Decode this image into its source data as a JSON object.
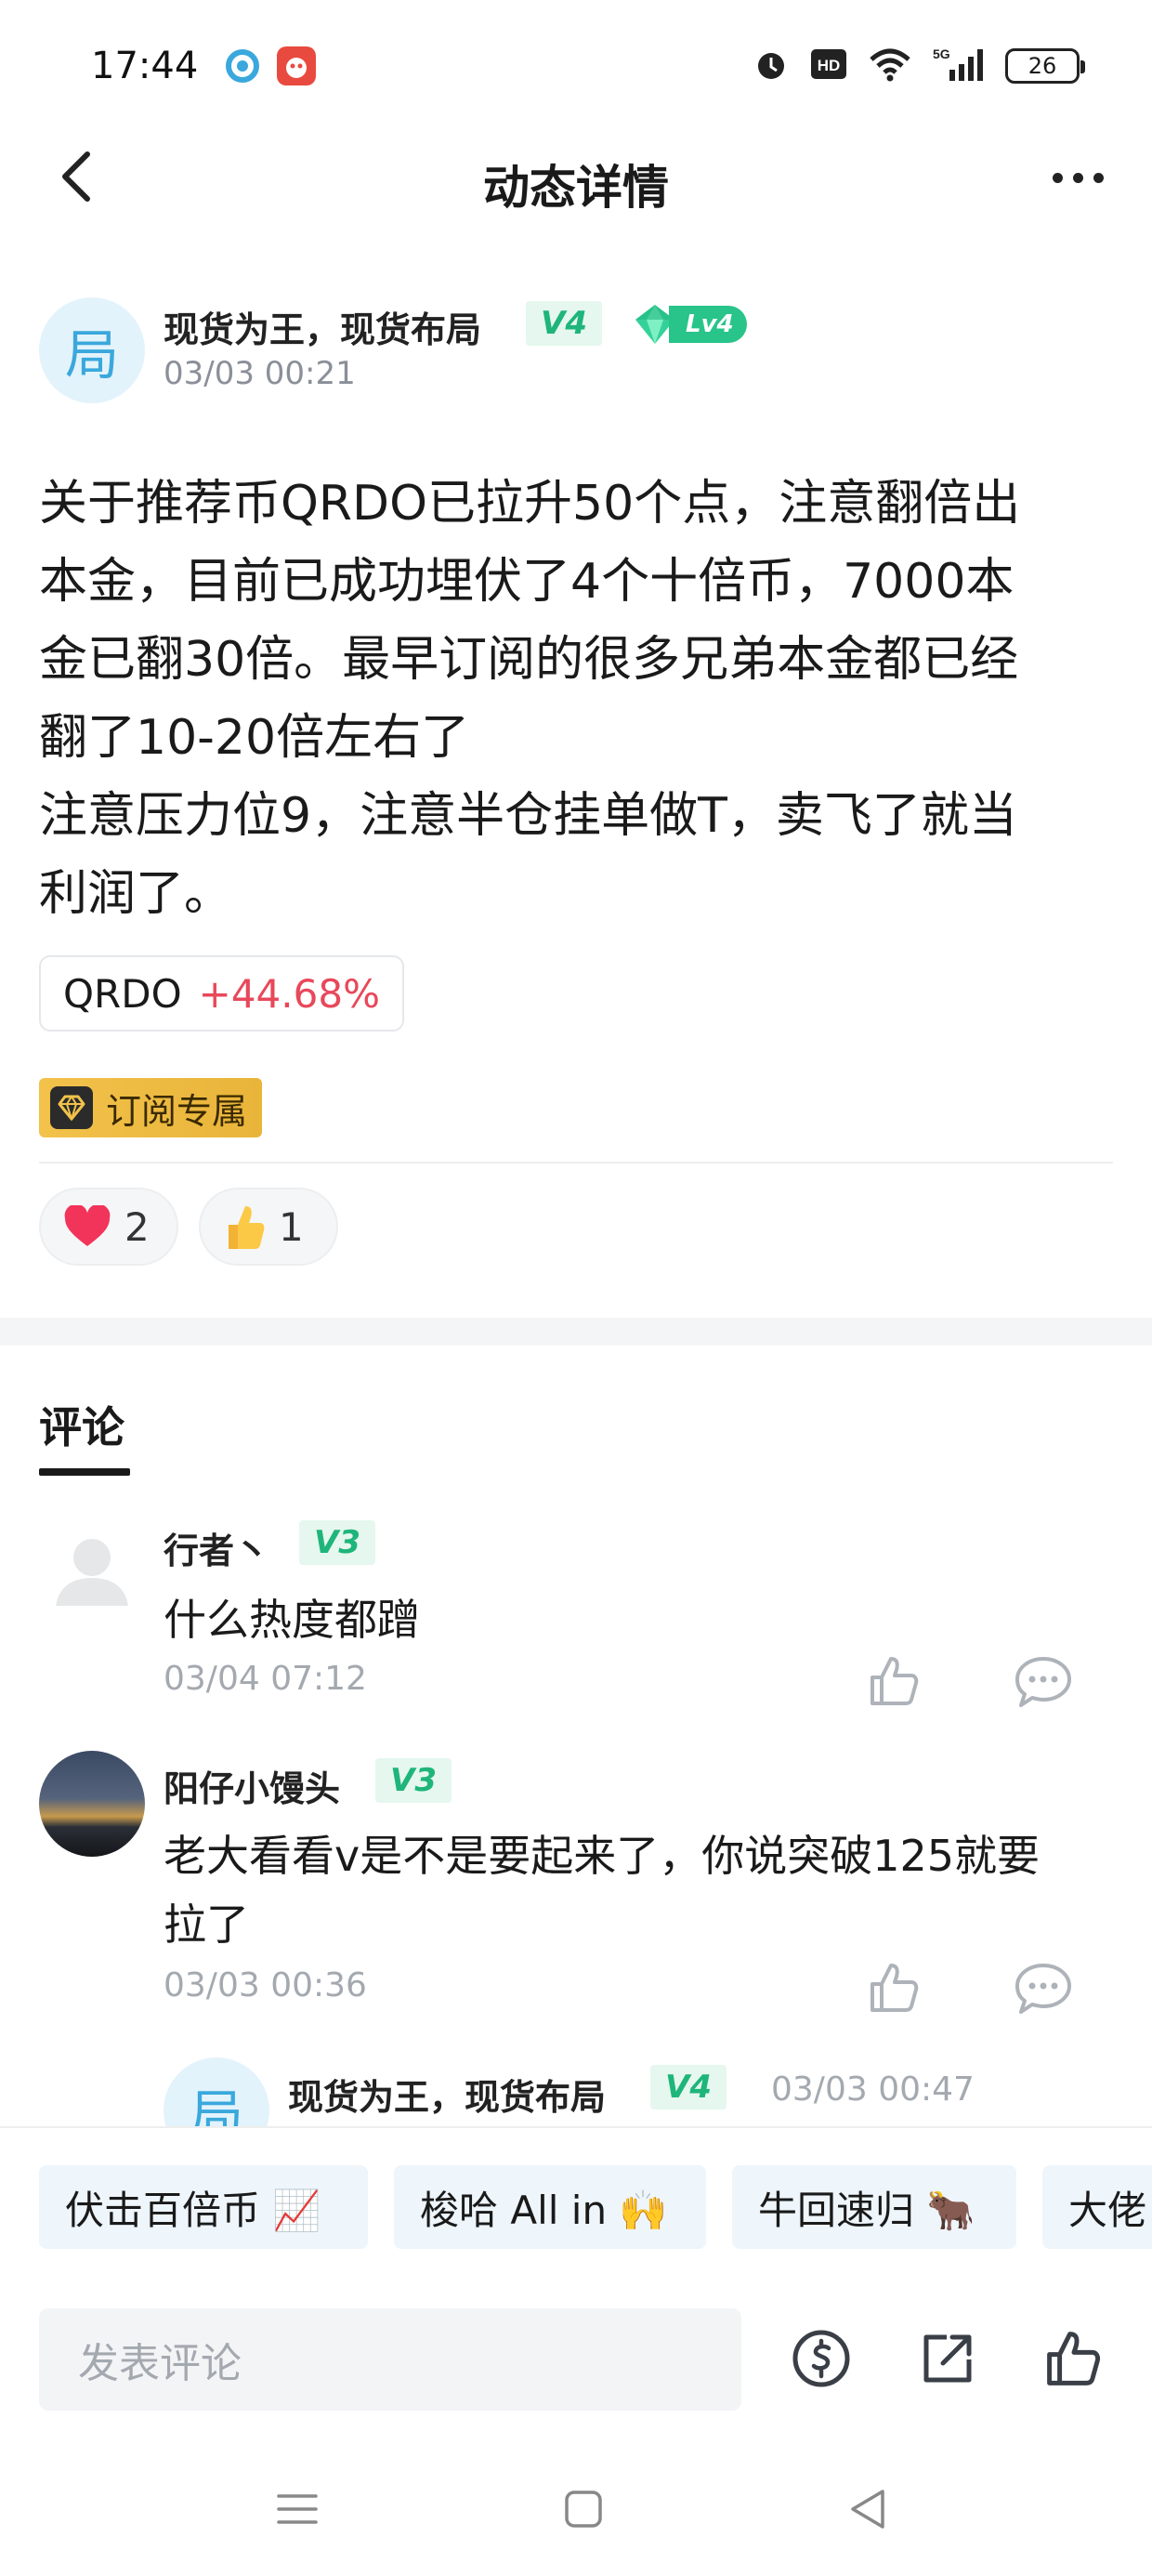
{
  "status_bar": {
    "time": "17:44",
    "battery": "26",
    "icons": [
      "alarm-icon",
      "hd-icon",
      "wifi-icon",
      "signal-5g-icon",
      "battery-icon"
    ]
  },
  "nav": {
    "title": "动态详情",
    "back_icon": "chevron-left-icon",
    "more_icon": "more-dots-icon"
  },
  "post": {
    "avatar_char": "局",
    "author": "现货为王，现货布局",
    "vip_level": "V4",
    "user_level": "Lv4",
    "time": "03/03 00:21",
    "body_lines": [
      "关于推荐币QRDO已拉升50个点，注意翻倍出",
      "本金，目前已成功埋伏了4个十倍币，7000本",
      "金已翻30倍。最早订阅的很多兄弟本金都已经",
      "翻了10-20倍左右了",
      "注意压力位9，注意半仓挂单做T，卖飞了就当",
      "利润了。"
    ],
    "coin": {
      "name": "QRDO",
      "change": "+44.68%"
    },
    "subscription_badge": "订阅专属",
    "reactions": [
      {
        "icon": "heart-icon",
        "count": "2"
      },
      {
        "icon": "thumbs-up-emoji-icon",
        "count": "1"
      }
    ]
  },
  "comments": {
    "tab_label": "评论",
    "items": [
      {
        "name": "行者丶",
        "vip_level": "V3",
        "text_lines": [
          "什么热度都蹭"
        ],
        "time": "03/04 07:12"
      },
      {
        "name": "阳仔小馒头",
        "vip_level": "V3",
        "text_lines": [
          "老大看看v是不是要起来了，你说突破125就要",
          "拉了"
        ],
        "time": "03/03 00:36"
      }
    ],
    "reply": {
      "avatar_char": "局",
      "name": "现货为王，现货布局",
      "vip_level": "V4",
      "time": "03/03 00:47"
    }
  },
  "bottom": {
    "quick_replies": [
      "伏击百倍币 📈",
      "梭哈 All in 🙌",
      "牛回速归 🐂",
      "大佬"
    ],
    "comment_placeholder": "发表评论"
  },
  "colors": {
    "accent_green": "#1fb57a",
    "price_up": "#e8485a",
    "brand_blue": "#3aa8dc",
    "gold": "#f2c24a"
  }
}
